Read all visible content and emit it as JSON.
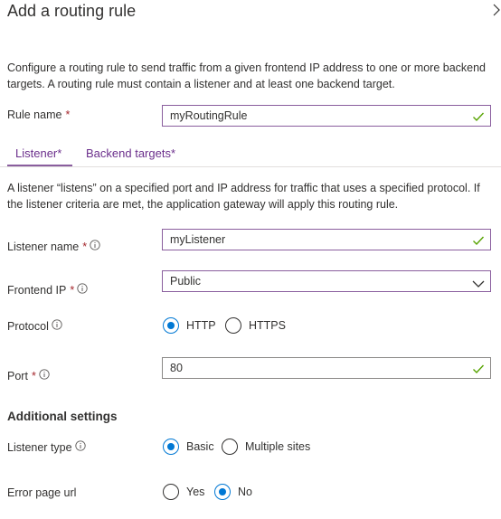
{
  "panel": {
    "title": "Add a routing rule",
    "description": "Configure a routing rule to send traffic from a given frontend IP address to one or more backend targets. A routing rule must contain a listener and at least one backend target."
  },
  "rule_name": {
    "label": "Rule name",
    "required_mark": "*",
    "value": "myRoutingRule"
  },
  "tabs": [
    {
      "label": "Listener",
      "required_mark": "*",
      "selected": true
    },
    {
      "label": "Backend targets",
      "required_mark": "*",
      "selected": false
    }
  ],
  "listener": {
    "description": "A listener “listens” on a specified port and IP address for traffic that uses a specified protocol. If the listener criteria are met, the application gateway will apply this routing rule.",
    "listener_name": {
      "label": "Listener name",
      "required_mark": "*",
      "value": "myListener"
    },
    "frontend_ip": {
      "label": "Frontend IP",
      "required_mark": "*",
      "selected": "Public"
    },
    "protocol": {
      "label": "Protocol",
      "options": [
        "HTTP",
        "HTTPS"
      ],
      "selected": "HTTP"
    },
    "port": {
      "label": "Port",
      "required_mark": "*",
      "value": "80"
    }
  },
  "additional_settings": {
    "heading": "Additional settings",
    "listener_type": {
      "label": "Listener type",
      "options": [
        "Basic",
        "Multiple sites"
      ],
      "selected": "Basic"
    },
    "error_page_url": {
      "label": "Error page url",
      "options": [
        "Yes",
        "No"
      ],
      "selected": "No"
    }
  },
  "colors": {
    "accent": "#0078d4",
    "tab_text": "#6b2f8c",
    "focus_border": "#8a5e9e",
    "valid_check": "#57a300",
    "required": "#a4262c"
  }
}
